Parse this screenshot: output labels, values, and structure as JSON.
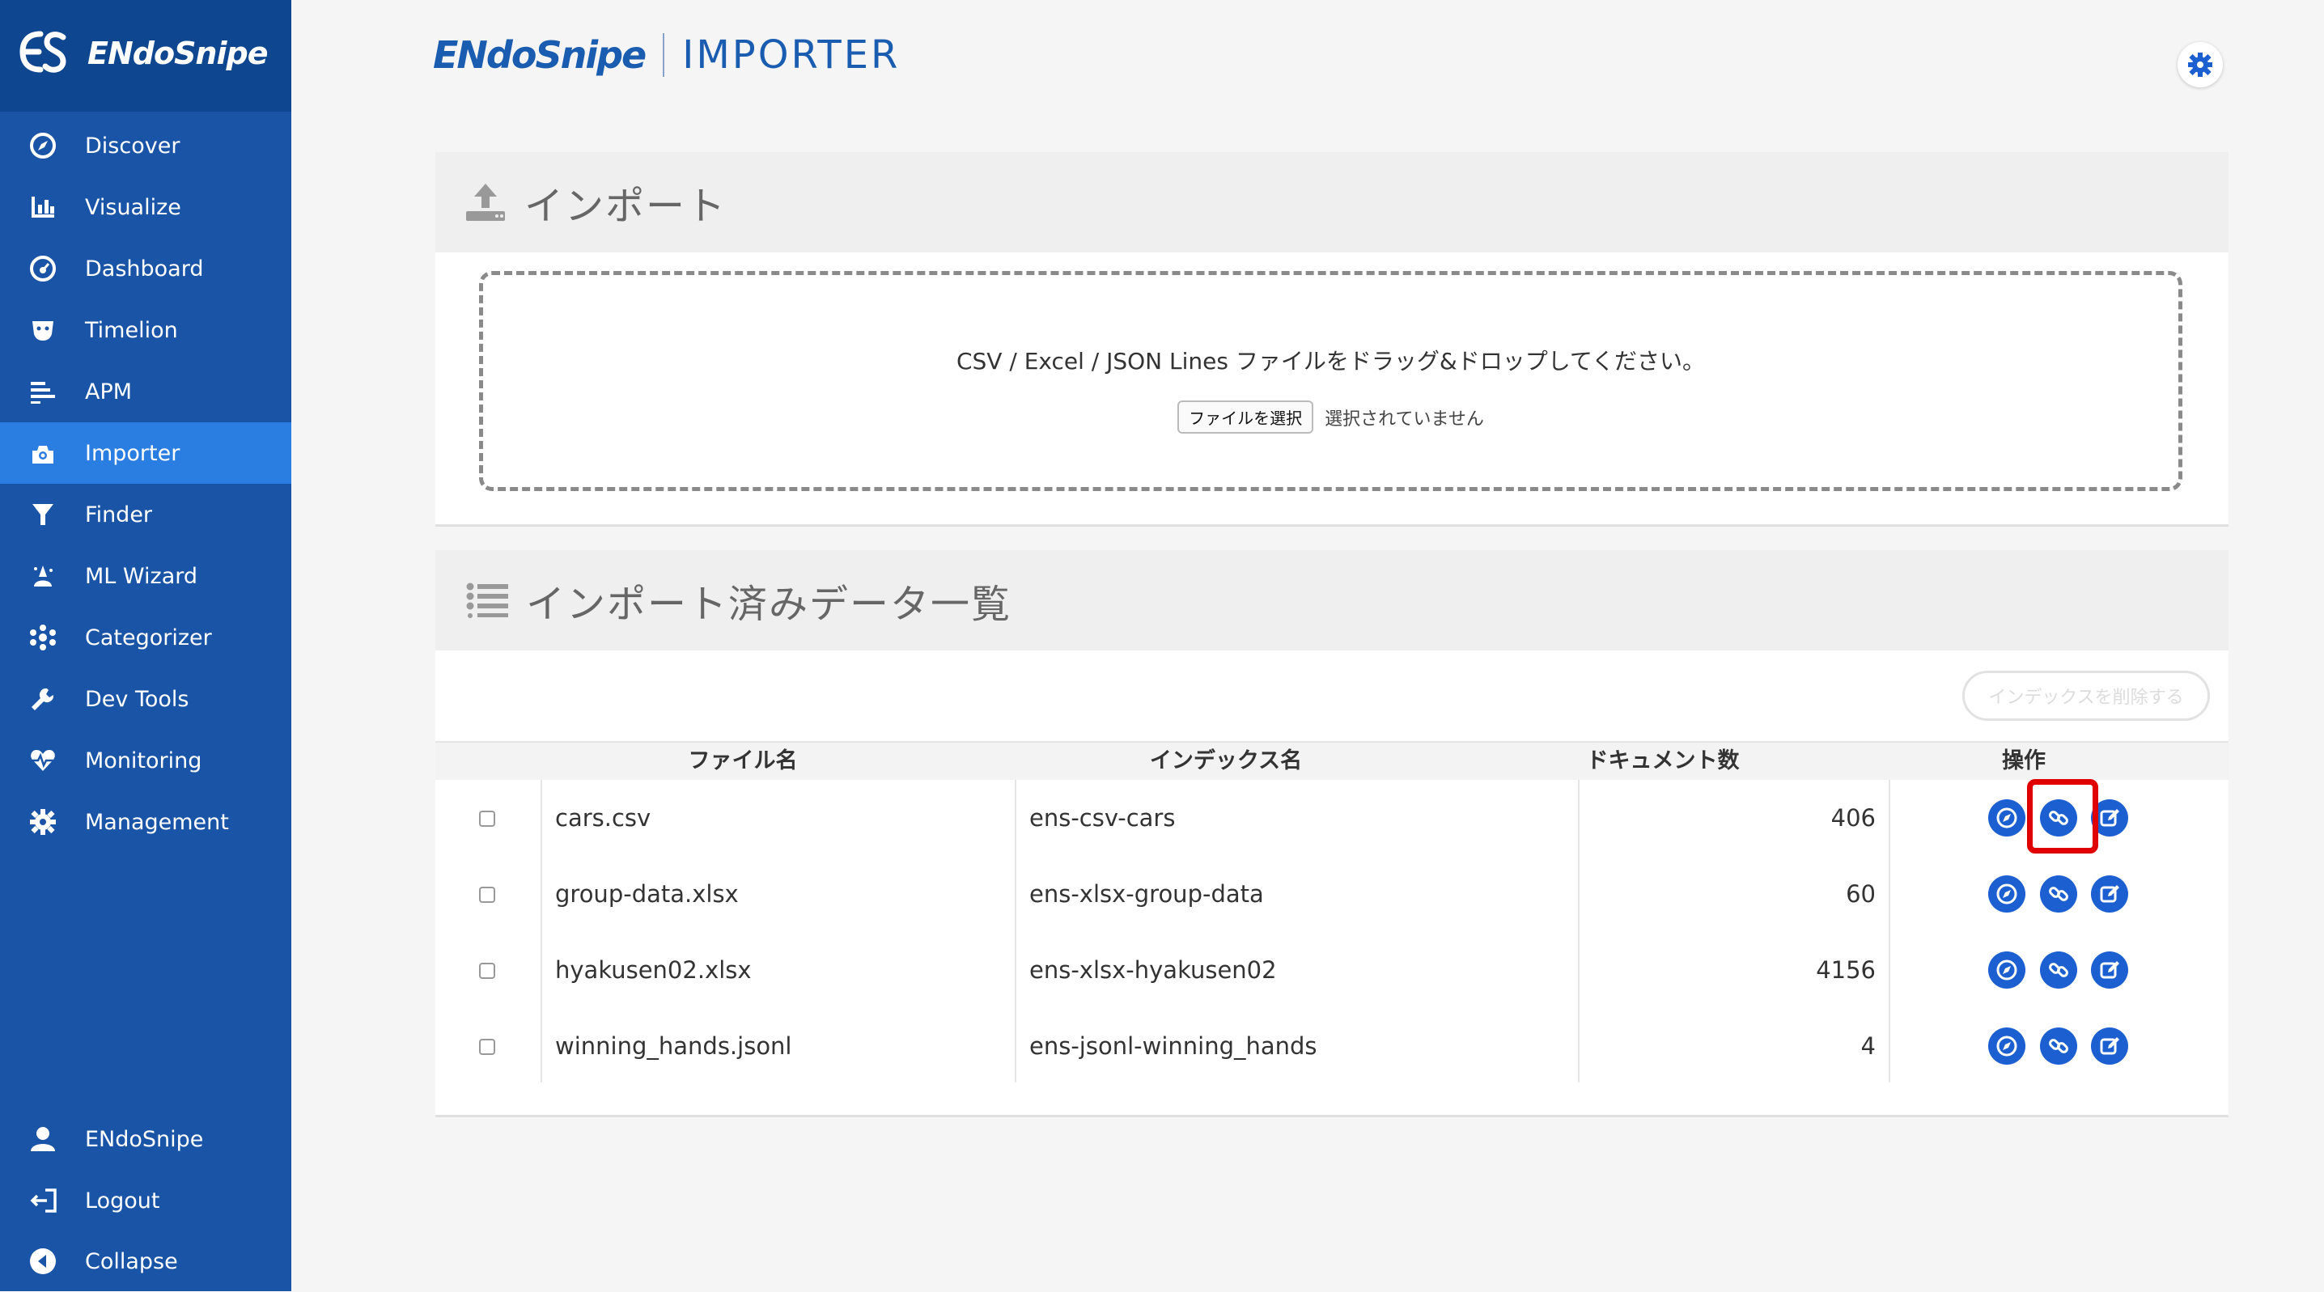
{
  "sidebar": {
    "brand": "ENdoSnipe",
    "items": [
      {
        "label": "Discover",
        "icon": "compass-icon"
      },
      {
        "label": "Visualize",
        "icon": "bar-chart-icon"
      },
      {
        "label": "Dashboard",
        "icon": "dashboard-icon"
      },
      {
        "label": "Timelion",
        "icon": "timelion-icon"
      },
      {
        "label": "APM",
        "icon": "apm-icon"
      },
      {
        "label": "Importer",
        "icon": "importer-icon",
        "active": true
      },
      {
        "label": "Finder",
        "icon": "filter-icon"
      },
      {
        "label": "ML Wizard",
        "icon": "ml-wizard-icon"
      },
      {
        "label": "Categorizer",
        "icon": "categorizer-icon"
      },
      {
        "label": "Dev Tools",
        "icon": "wrench-icon"
      },
      {
        "label": "Monitoring",
        "icon": "heartbeat-icon"
      },
      {
        "label": "Management",
        "icon": "gear-icon"
      }
    ],
    "bottom_items": [
      {
        "label": "ENdoSnipe",
        "icon": "user-icon"
      },
      {
        "label": "Logout",
        "icon": "logout-icon"
      },
      {
        "label": "Collapse",
        "icon": "collapse-icon"
      }
    ]
  },
  "header": {
    "logo_left": "ENdoSnipe",
    "logo_right": "IMPORTER"
  },
  "import_section": {
    "title": "インポート",
    "drop_message": "CSV / Excel / JSON Lines ファイルをドラッグ&ドロップしてください。",
    "file_button": "ファイルを選択",
    "file_status": "選択されていません"
  },
  "list_section": {
    "title": "インポート済みデータ一覧",
    "delete_button": "インデックスを削除する",
    "columns": [
      "ファイル名",
      "インデックス名",
      "ドキュメント数",
      "操作"
    ],
    "rows": [
      {
        "file": "cars.csv",
        "index": "ens-csv-cars",
        "docs": "406"
      },
      {
        "file": "group-data.xlsx",
        "index": "ens-xlsx-group-data",
        "docs": "60"
      },
      {
        "file": "hyakusen02.xlsx",
        "index": "ens-xlsx-hyakusen02",
        "docs": "4156"
      },
      {
        "file": "winning_hands.jsonl",
        "index": "ens-jsonl-winning_hands",
        "docs": "4"
      }
    ],
    "action_icons": [
      "compass-icon",
      "link-icon",
      "edit-icon"
    ],
    "highlighted": "link-icon in first row"
  },
  "colors": {
    "sidebar_bg": "#1954a7",
    "sidebar_brand_bg": "#0e4690",
    "active_item_bg": "#2a7de1",
    "accent": "#1c5fd0",
    "highlight_border": "#e00000"
  }
}
